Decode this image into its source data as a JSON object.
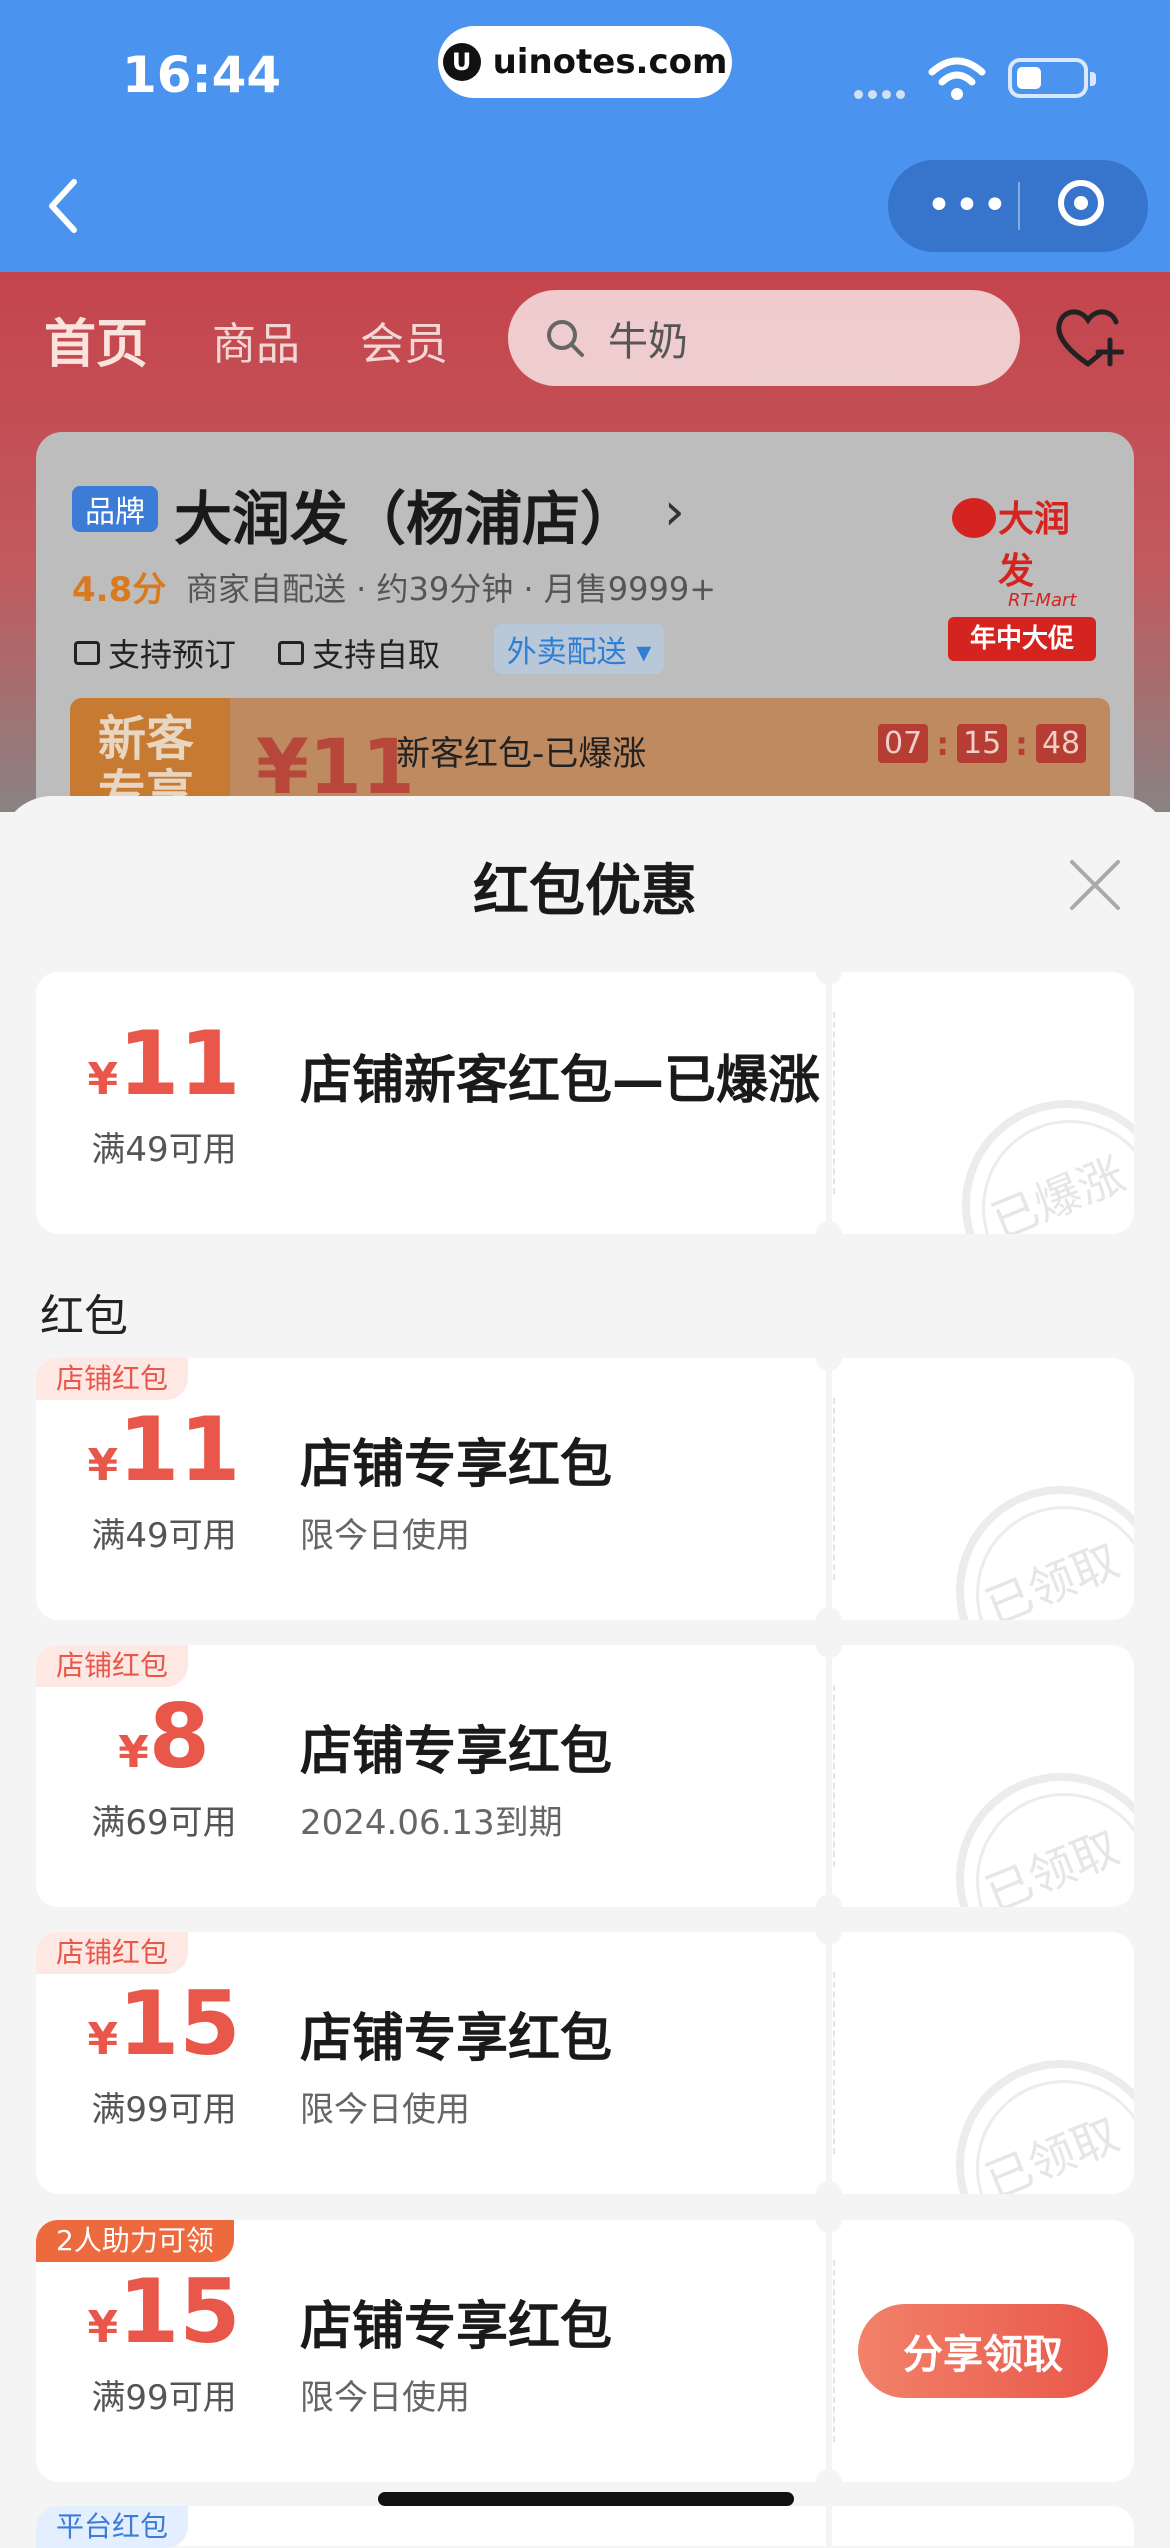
{
  "status_bar": {
    "time": "16:44",
    "url": "uinotes.com",
    "url_logo": "U"
  },
  "store": {
    "nav": {
      "home": "首页",
      "goods": "商品",
      "member": "会员"
    },
    "search_placeholder": "牛奶",
    "brand_tag": "品牌",
    "name": "大润发（杨浦店）",
    "rating": "4.8分",
    "meta": "商家自配送 · 约39分钟 · 月售9999+",
    "logo_text": "大润发",
    "logo_sub": "RT-Mart",
    "logo_badge": "年中大促",
    "features": [
      "支持预订",
      "支持自取"
    ],
    "delivery_tag": "外卖配送 ▾",
    "new_customer": {
      "label": "新客专享",
      "amount": "¥11",
      "title": "新客红包-已爆涨",
      "timer": [
        "07",
        "15",
        "48"
      ]
    }
  },
  "sheet": {
    "title": "红包优惠",
    "section_label": "红包",
    "coupons": [
      {
        "tag": "",
        "currency": "¥",
        "amount": "11",
        "condition": "满49可用",
        "title": "店铺新客红包—已爆涨",
        "subtitle": "",
        "stamp": "已爆涨",
        "action": ""
      },
      {
        "tag": "店铺红包",
        "currency": "¥",
        "amount": "11",
        "condition": "满49可用",
        "title": "店铺专享红包",
        "subtitle": "限今日使用",
        "stamp": "已领取",
        "action": ""
      },
      {
        "tag": "店铺红包",
        "currency": "¥",
        "amount": "8",
        "condition": "满69可用",
        "title": "店铺专享红包",
        "subtitle": "2024.06.13到期",
        "stamp": "已领取",
        "action": ""
      },
      {
        "tag": "店铺红包",
        "currency": "¥",
        "amount": "15",
        "condition": "满99可用",
        "title": "店铺专享红包",
        "subtitle": "限今日使用",
        "stamp": "已领取",
        "action": ""
      },
      {
        "tag": "2人助力可领",
        "currency": "¥",
        "amount": "15",
        "condition": "满99可用",
        "title": "店铺专享红包",
        "subtitle": "限今日使用",
        "stamp": "",
        "action": "分享领取"
      }
    ],
    "next_tag": "平台红包"
  },
  "colors": {
    "primary_blue": "#4a93ee",
    "coupon_red": "#e9574a"
  }
}
